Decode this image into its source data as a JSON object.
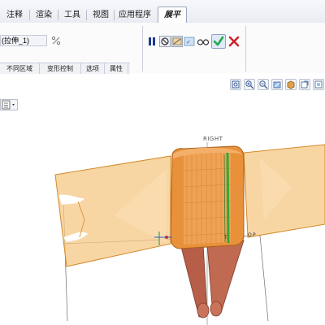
{
  "menubar": {
    "tabs": [
      {
        "label": "注释",
        "active": false
      },
      {
        "label": "渲染",
        "active": false
      },
      {
        "label": "工具",
        "active": false
      },
      {
        "label": "视图",
        "active": false
      },
      {
        "label": "应用程序",
        "active": false
      },
      {
        "label": "展平",
        "active": true
      }
    ]
  },
  "ribbon": {
    "feature_name": "(拉伸_1)",
    "subtabs": [
      "不同区域",
      "变形控制",
      "选项",
      "属性"
    ],
    "controls": [
      "pause-icon",
      "no-preview-icon",
      "preview-icon",
      "verify-icon",
      "glasses-icon",
      "checkmark-icon",
      "cancel-icon"
    ],
    "accept_color": "#22a84a",
    "cancel_color": "#d0242a",
    "active_color": "#1b3a8c"
  },
  "viewport": {
    "plane_label": "RIGHT",
    "axis_labels": [
      "T",
      "O",
      "P"
    ],
    "model_color_flat": "#f3b54a",
    "model_color_body": "#e8913a",
    "model_color_legs": "#b65e48",
    "highlight_color": "#2eaa3a"
  }
}
